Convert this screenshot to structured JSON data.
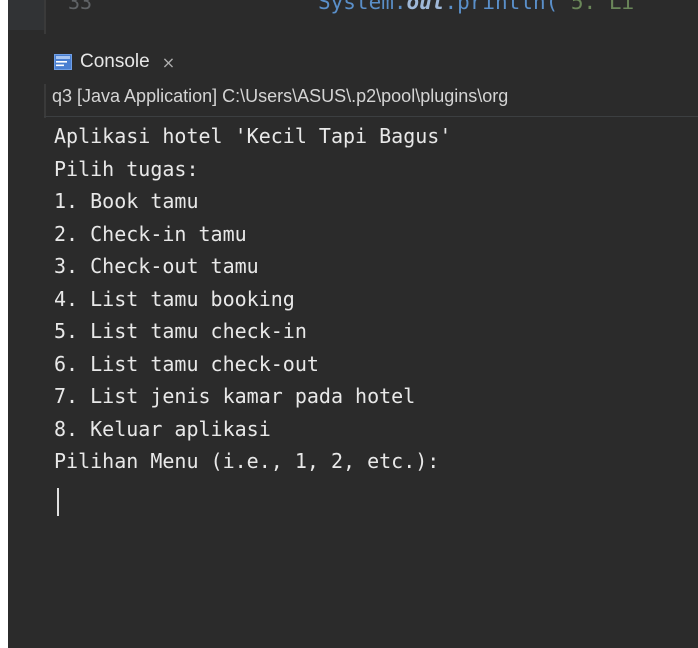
{
  "editor": {
    "line_number": "33",
    "code": {
      "prefix": "System.",
      "keyword": "out",
      "method": ".println(",
      "string": "\"5. Li"
    }
  },
  "console_tab": {
    "label": "Console",
    "icon": "console-icon",
    "close_icon": "close-icon",
    "close_glyph": "×"
  },
  "launch": {
    "description": "q3 [Java Application] C:\\Users\\ASUS\\.p2\\pool\\plugins\\org"
  },
  "output": {
    "lines": [
      "Aplikasi hotel 'Kecil Tapi Bagus'",
      "Pilih tugas:",
      "1. Book tamu",
      "2. Check-in tamu",
      "3. Check-out tamu",
      "4. List tamu booking",
      "5. List tamu check-in",
      "6. List tamu check-out",
      "7. List jenis kamar pada hotel",
      "8. Keluar aplikasi",
      "Pilihan Menu (i.e., 1, 2, etc.):"
    ]
  },
  "colors": {
    "background": "#2b2b2b",
    "text": "#e8e8e8",
    "code_blue": "#5a8fc9",
    "icon_blue": "#4a7fd1"
  }
}
